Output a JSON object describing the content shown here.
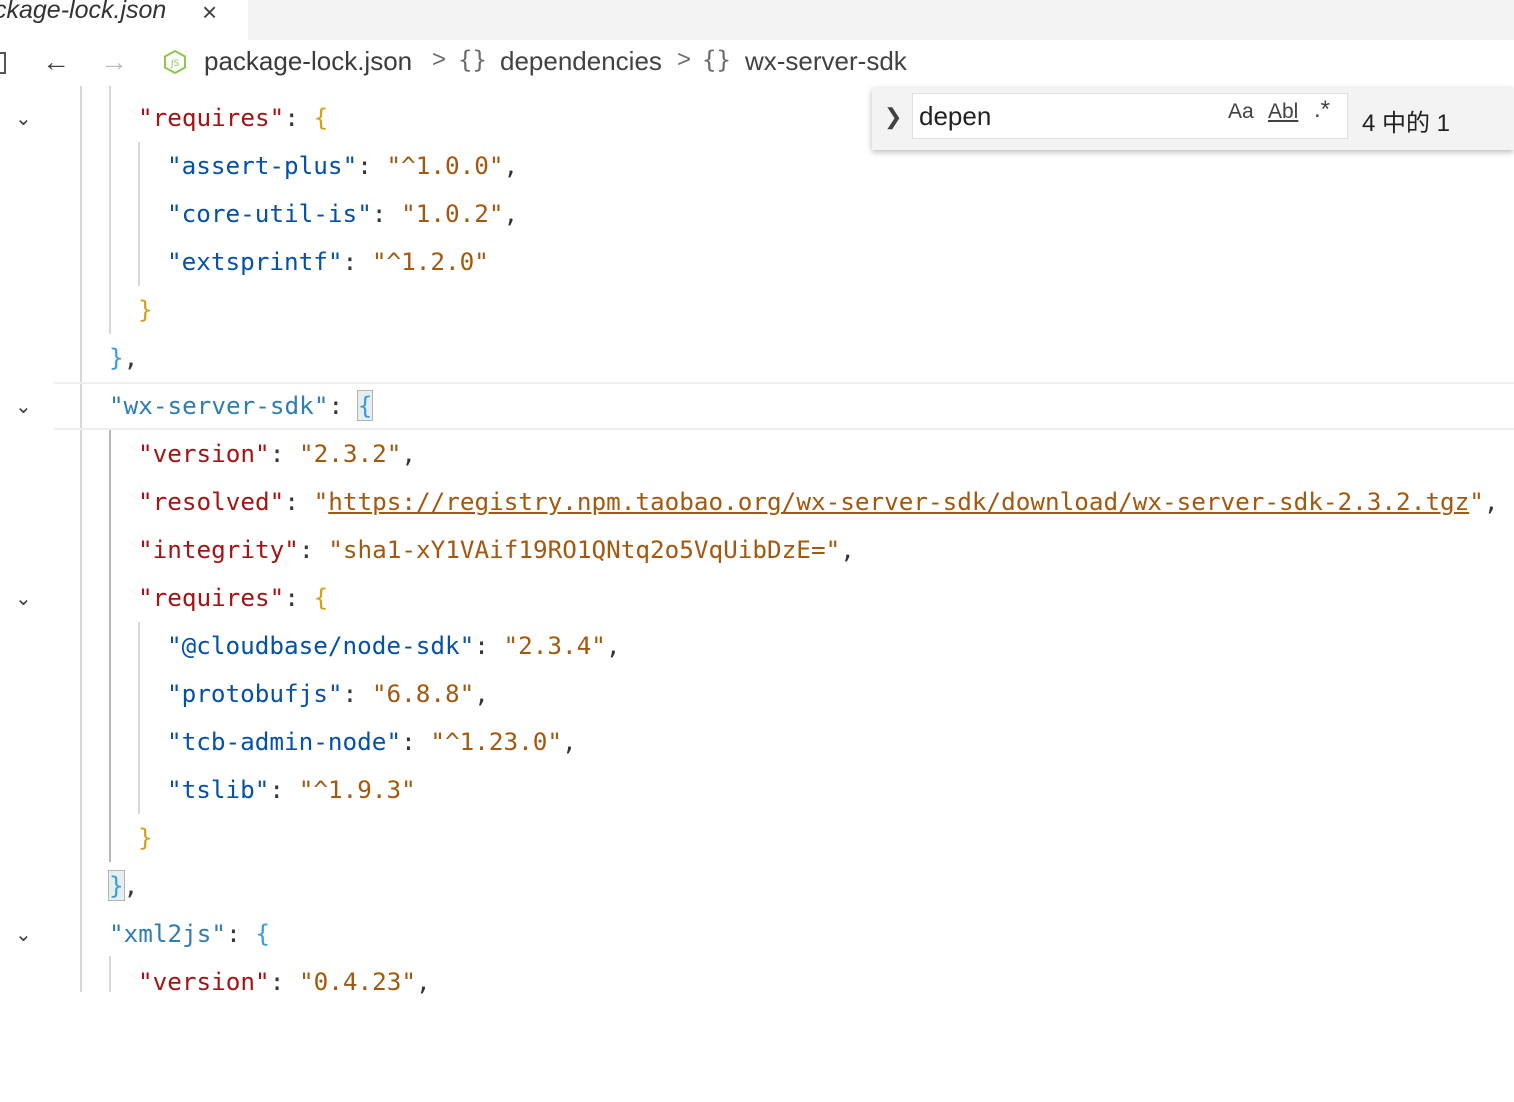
{
  "tab": {
    "label": "ckage-lock.json",
    "close_icon": "×"
  },
  "breadcrumb": {
    "file": "package-lock.json",
    "items": [
      "dependencies",
      "wx-server-sdk"
    ],
    "separator": ">",
    "object_icon": "{}"
  },
  "find": {
    "query": "depen",
    "match_case": "Aa",
    "whole_word": "Abl",
    "regex": ".*",
    "count": "4 中的 1"
  },
  "code": {
    "l1_key": "requires",
    "l1_open": "{",
    "l2_key": "assert-plus",
    "l2_val": "^1.0.0",
    "l3_key": "core-util-is",
    "l3_val": "1.0.2",
    "l4_key": "extsprintf",
    "l4_val": "^1.2.0",
    "l5_close": "}",
    "l6_close": "}",
    "l7_key": "wx-server-sdk",
    "l7_open": "{",
    "l8_key": "version",
    "l8_val": "2.3.2",
    "l9_key": "resolved",
    "l9_val": "https://registry.npm.taobao.org/wx-server-sdk/download/wx-server-sdk-2.3.2.tgz",
    "l10_key": "integrity",
    "l10_val": "sha1-xY1VAif19RO1QNtq2o5VqUibDzE=",
    "l11_key": "requires",
    "l11_open": "{",
    "l12_key": "@cloudbase/node-sdk",
    "l12_val": "2.3.4",
    "l13_key": "protobufjs",
    "l13_val": "6.8.8",
    "l14_key": "tcb-admin-node",
    "l14_val": "^1.23.0",
    "l15_key": "tslib",
    "l15_val": "^1.9.3",
    "l16_close": "}",
    "l17_close": "}",
    "l18_key": "xml2js",
    "l18_open": "{",
    "l19_key": "version",
    "l19_val": "0.4.23"
  }
}
